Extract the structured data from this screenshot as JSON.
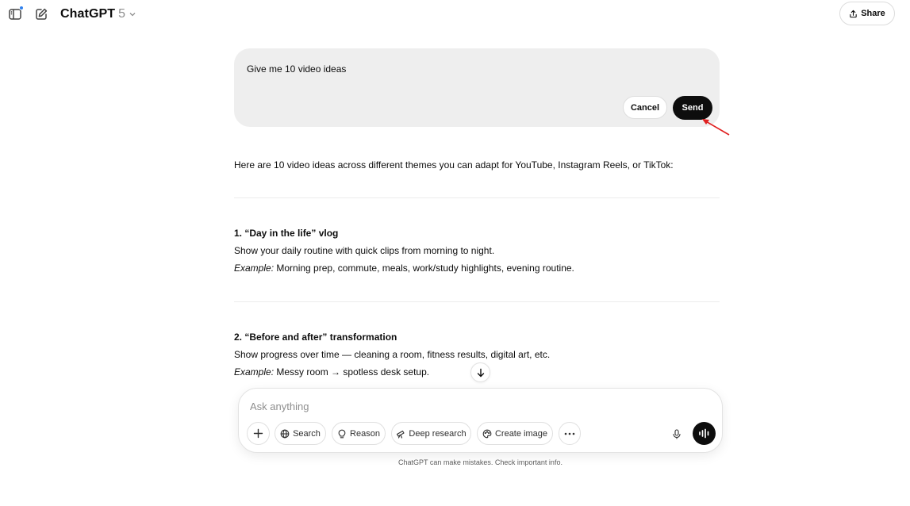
{
  "header": {
    "model_name": "ChatGPT",
    "model_version": "5",
    "share_label": "Share"
  },
  "edit": {
    "text": "Give me 10 video ideas",
    "cancel_label": "Cancel",
    "send_label": "Send"
  },
  "response": {
    "intro": "Here are 10 video ideas across different themes you can adapt for YouTube, Instagram Reels, or TikTok:",
    "sections": [
      {
        "title": "1. “Day in the life” vlog",
        "description": "Show your daily routine with quick clips from morning to night.",
        "example_label": "Example:",
        "example": " Morning prep, commute, meals, work/study highlights, evening routine."
      },
      {
        "title": "2. “Before and after” transformation",
        "description": "Show progress over time — cleaning a room, fitness results, digital art, etc.",
        "example_label": "Example:",
        "example": " Messy room → spotless desk setup."
      }
    ]
  },
  "composer": {
    "placeholder": "Ask anything",
    "tools": {
      "search": "Search",
      "reason": "Reason",
      "deep_research": "Deep research",
      "create_image": "Create image"
    }
  },
  "disclaimer": "ChatGPT can make mistakes. Check important info.",
  "colors": {
    "accent_dot": "#2f80ed",
    "annotation_arrow": "#e02020",
    "send_bg": "#0d0d0d"
  }
}
